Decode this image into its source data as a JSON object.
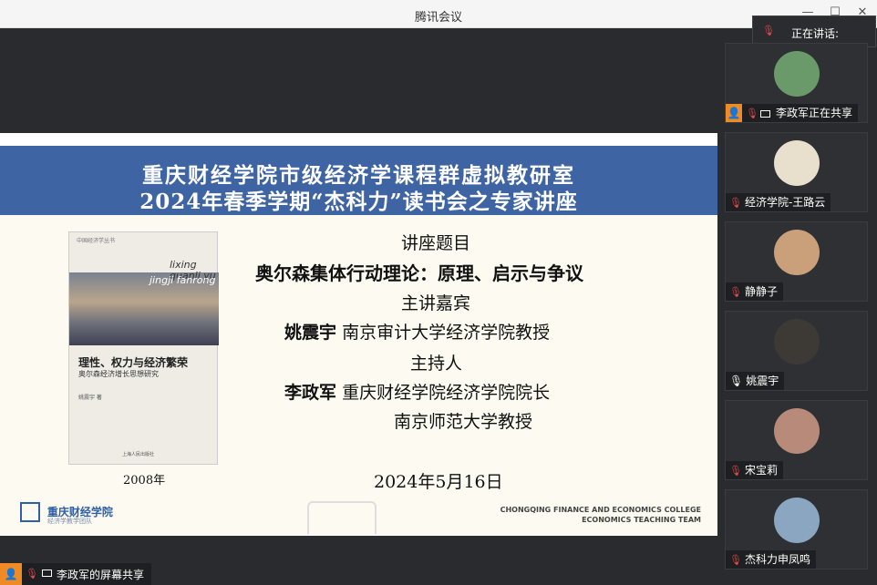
{
  "window": {
    "title": "腾讯会议",
    "min_icon": "minimize-icon",
    "max_icon": "maximize-icon",
    "close_icon": "close-icon"
  },
  "speaking": {
    "label": "正在讲话:"
  },
  "slide": {
    "banner_line1": "重庆财经学院市级经济学课程群虚拟教研室",
    "banner_line2": "2024年春季学期“杰科力”读书会之专家讲座",
    "topic_label": "讲座题目",
    "topic": "奥尔森集体行动理论：原理、启示与争议",
    "speaker_label": "主讲嘉宾",
    "speaker_name": "姚震宇",
    "speaker_title": "南京审计大学经济学院教授",
    "host_label": "主持人",
    "host_name": "李政军",
    "host_title1": "重庆财经学院经济学院院长",
    "host_title2": "南京师范大学教授",
    "date": "2024年5月16日",
    "book_year": "2008年",
    "book_series": "中国经济学丛书",
    "book_pinyin1": "lixing quanli yu",
    "book_pinyin2": "jingji fanrong",
    "book_title": "理性、权力与经济繁荣",
    "book_subtitle": "奥尔森经济增长思想研究",
    "book_author": "姚震宇 著",
    "book_publisher": "上海人民出版社",
    "logo_text": "重庆财经学院",
    "logo_sub": "经济学教学团队",
    "eng_line1": "CHONGQING FINANCE AND ECONOMICS COLLEGE",
    "eng_line2": "ECONOMICS TEACHING TEAM"
  },
  "bottombar": {
    "label": "李政军的屏幕共享"
  },
  "participants": [
    {
      "name": "李政军正在共享",
      "avatar_color": "#6a9a6a"
    },
    {
      "name": "经济学院-王路云",
      "avatar_color": "#e8e0cc"
    },
    {
      "name": "静静子",
      "avatar_color": "#c9a07a"
    },
    {
      "name": "姚震宇",
      "avatar_color": "#3d3a36"
    },
    {
      "name": "宋宝莉",
      "avatar_color": "#b88a7a"
    },
    {
      "name": "杰科力申凤鸣",
      "avatar_color": "#8aa6c0"
    }
  ]
}
